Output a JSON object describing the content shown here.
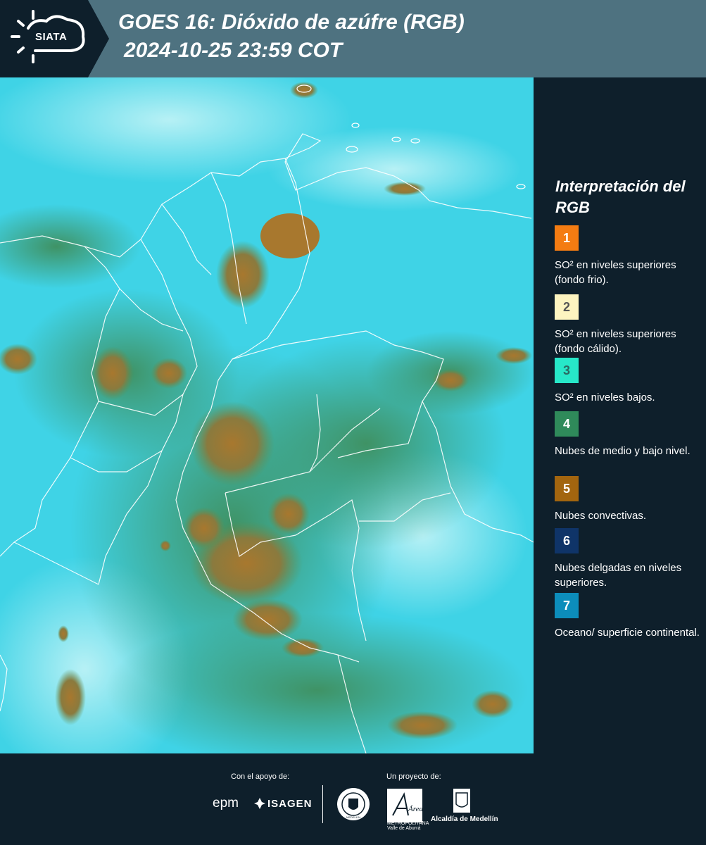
{
  "header": {
    "logo_text": "SIATA",
    "title": "GOES 16: Dióxido de azúfre (RGB)",
    "subtitle": "2024-10-25 23:59 COT"
  },
  "legend": {
    "title": "Interpretación del RGB",
    "items": [
      {
        "number": "1",
        "text": "SO² en niveles superiores (fondo frio).",
        "color": "#f47c12"
      },
      {
        "number": "2",
        "text": "SO² en niveles superiores (fondo cálido).",
        "color": "#fdf4c0"
      },
      {
        "number": "3",
        "text": "SO² en niveles bajos.",
        "color": "#27e8c9"
      },
      {
        "number": "4",
        "text": "Nubes de medio y bajo nivel.",
        "color": "#2f8a5a"
      },
      {
        "number": "5",
        "text": "Nubes convectivas.",
        "color": "#a2650f"
      },
      {
        "number": "6",
        "text": "Nubes delgadas en niveles superiores.",
        "color": "#0f3468"
      },
      {
        "number": "7",
        "text": "Oceano/ superficie continental.",
        "color": "#0c8dbb"
      }
    ]
  },
  "footer": {
    "support_label": "Con el apoyo de:",
    "project_label": "Un proyecto de:",
    "sponsors": [
      "epm",
      "ISAGEN"
    ],
    "seal_text": "MEDELLÍN",
    "area_text": "METROPOLITANA Valle de Aburrá",
    "area_logo": "Área",
    "alcaldia": "Alcaldía de Medellín"
  },
  "colors": {
    "header_bg": "#4e7280",
    "logo_bg": "#0e1f2b",
    "panel_bg": "#0e1f2b",
    "map_cyan": "#3fd3e6",
    "map_cloud": "#a3743a"
  }
}
